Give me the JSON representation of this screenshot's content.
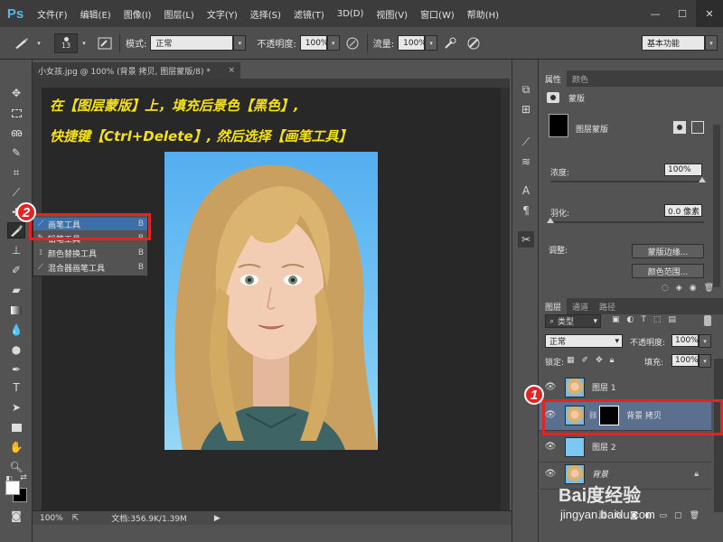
{
  "app": {
    "logo": "Ps"
  },
  "menu": [
    "文件(F)",
    "编辑(E)",
    "图像(I)",
    "图层(L)",
    "文字(Y)",
    "选择(S)",
    "滤镜(T)",
    "3D(D)",
    "视图(V)",
    "窗口(W)",
    "帮助(H)"
  ],
  "window_buttons": {
    "minimize": "—",
    "maximize": "☐",
    "close": "✕"
  },
  "options": {
    "brush_size": "13",
    "mode_label": "模式:",
    "mode_value": "正常",
    "opacity_label": "不透明度:",
    "opacity_value": "100%",
    "flow_label": "流量:",
    "flow_value": "100%",
    "workspace": "基本功能"
  },
  "document": {
    "tab_title": "小女孩.jpg @ 100% (背景 拷贝, 图层蒙版/8) *",
    "tab_close": "×",
    "zoom": "100%",
    "doc_info": "文档:356.9K/1.39M",
    "instruction_line1": "在【图层蒙版】上，填充后景色【黑色】,",
    "instruction_line2": "快捷键【Ctrl+Delete】, 然后选择【画笔工具】"
  },
  "tool_flyout": {
    "items": [
      {
        "label": "画笔工具",
        "key": "B",
        "icon": "brush-icon"
      },
      {
        "label": "铅笔工具",
        "key": "B",
        "icon": "pencil-icon"
      },
      {
        "label": "颜色替换工具",
        "key": "B",
        "icon": "color-replace-icon"
      },
      {
        "label": "混合器画笔工具",
        "key": "B",
        "icon": "mixer-brush-icon"
      }
    ]
  },
  "badges": {
    "step1": "1",
    "step2": "2"
  },
  "properties": {
    "tabs": [
      "属性",
      "颜色"
    ],
    "section": "蒙版",
    "mask_name": "图层蒙版",
    "density_label": "浓度:",
    "density_value": "100%",
    "feather_label": "羽化:",
    "feather_value": "0.0 像素",
    "adjust_label": "调整:",
    "mask_edge_button": "蒙版边缘...",
    "color_range_button": "颜色范围..."
  },
  "layers": {
    "tabs": [
      "图层",
      "通道",
      "路径"
    ],
    "filter_kind": "类型",
    "blend_mode": "正常",
    "opacity_label": "不透明度:",
    "opacity_value": "100%",
    "lock_label": "锁定:",
    "fill_label": "填充:",
    "fill_value": "100%",
    "rows": [
      {
        "name": "图层 1"
      },
      {
        "name": "背景 拷贝"
      },
      {
        "name": "图层 2"
      },
      {
        "name": "背景"
      }
    ]
  },
  "watermark": {
    "brand": "Bai度经验",
    "url": "jingyan.baidu.com"
  },
  "colors": {
    "highlight_red": "#e42424",
    "instruction_yellow": "#f5e11a",
    "selected_layer": "#5b6f8f"
  }
}
